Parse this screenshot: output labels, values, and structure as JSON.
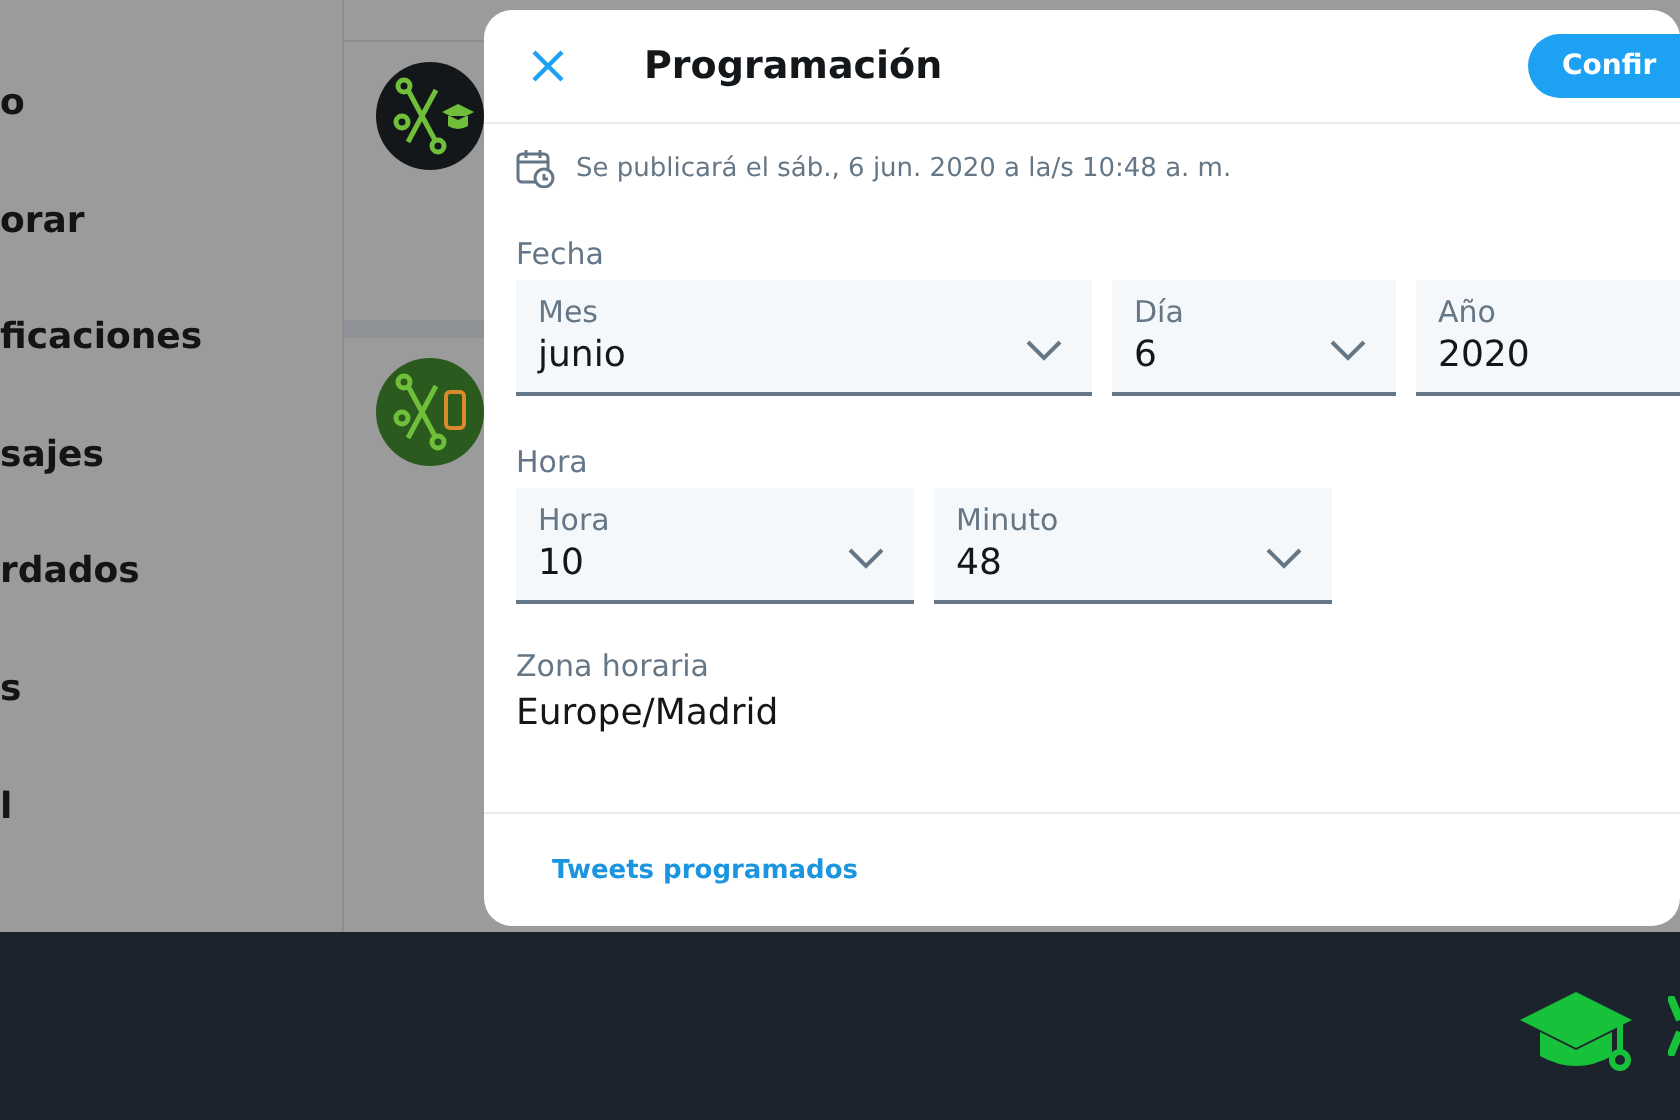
{
  "sidebar": {
    "items": [
      "o",
      "orar",
      "ficaciones",
      "sajes",
      "rdados",
      "s",
      "l"
    ]
  },
  "dialog": {
    "title": "Programación",
    "confirm": "Confir",
    "notice": "Se publicará el sáb., 6 jun. 2020 a la/s 10:48 a. m.",
    "sections": [
      {
        "label": "Fecha",
        "fields": [
          {
            "label": "Mes",
            "value": "junio",
            "kind": "dropdown"
          },
          {
            "label": "Día",
            "value": "6",
            "kind": "dropdown"
          },
          {
            "label": "Año",
            "value": "2020",
            "kind": "plain"
          }
        ]
      },
      {
        "label": "Hora",
        "fields": [
          {
            "label": "Hora",
            "value": "10",
            "kind": "dropdown"
          },
          {
            "label": "Minuto",
            "value": "48",
            "kind": "dropdown"
          }
        ]
      }
    ],
    "timezone": {
      "label": "Zona horaria",
      "value": "Europe/Madrid"
    },
    "footer_link": "Tweets programados"
  }
}
